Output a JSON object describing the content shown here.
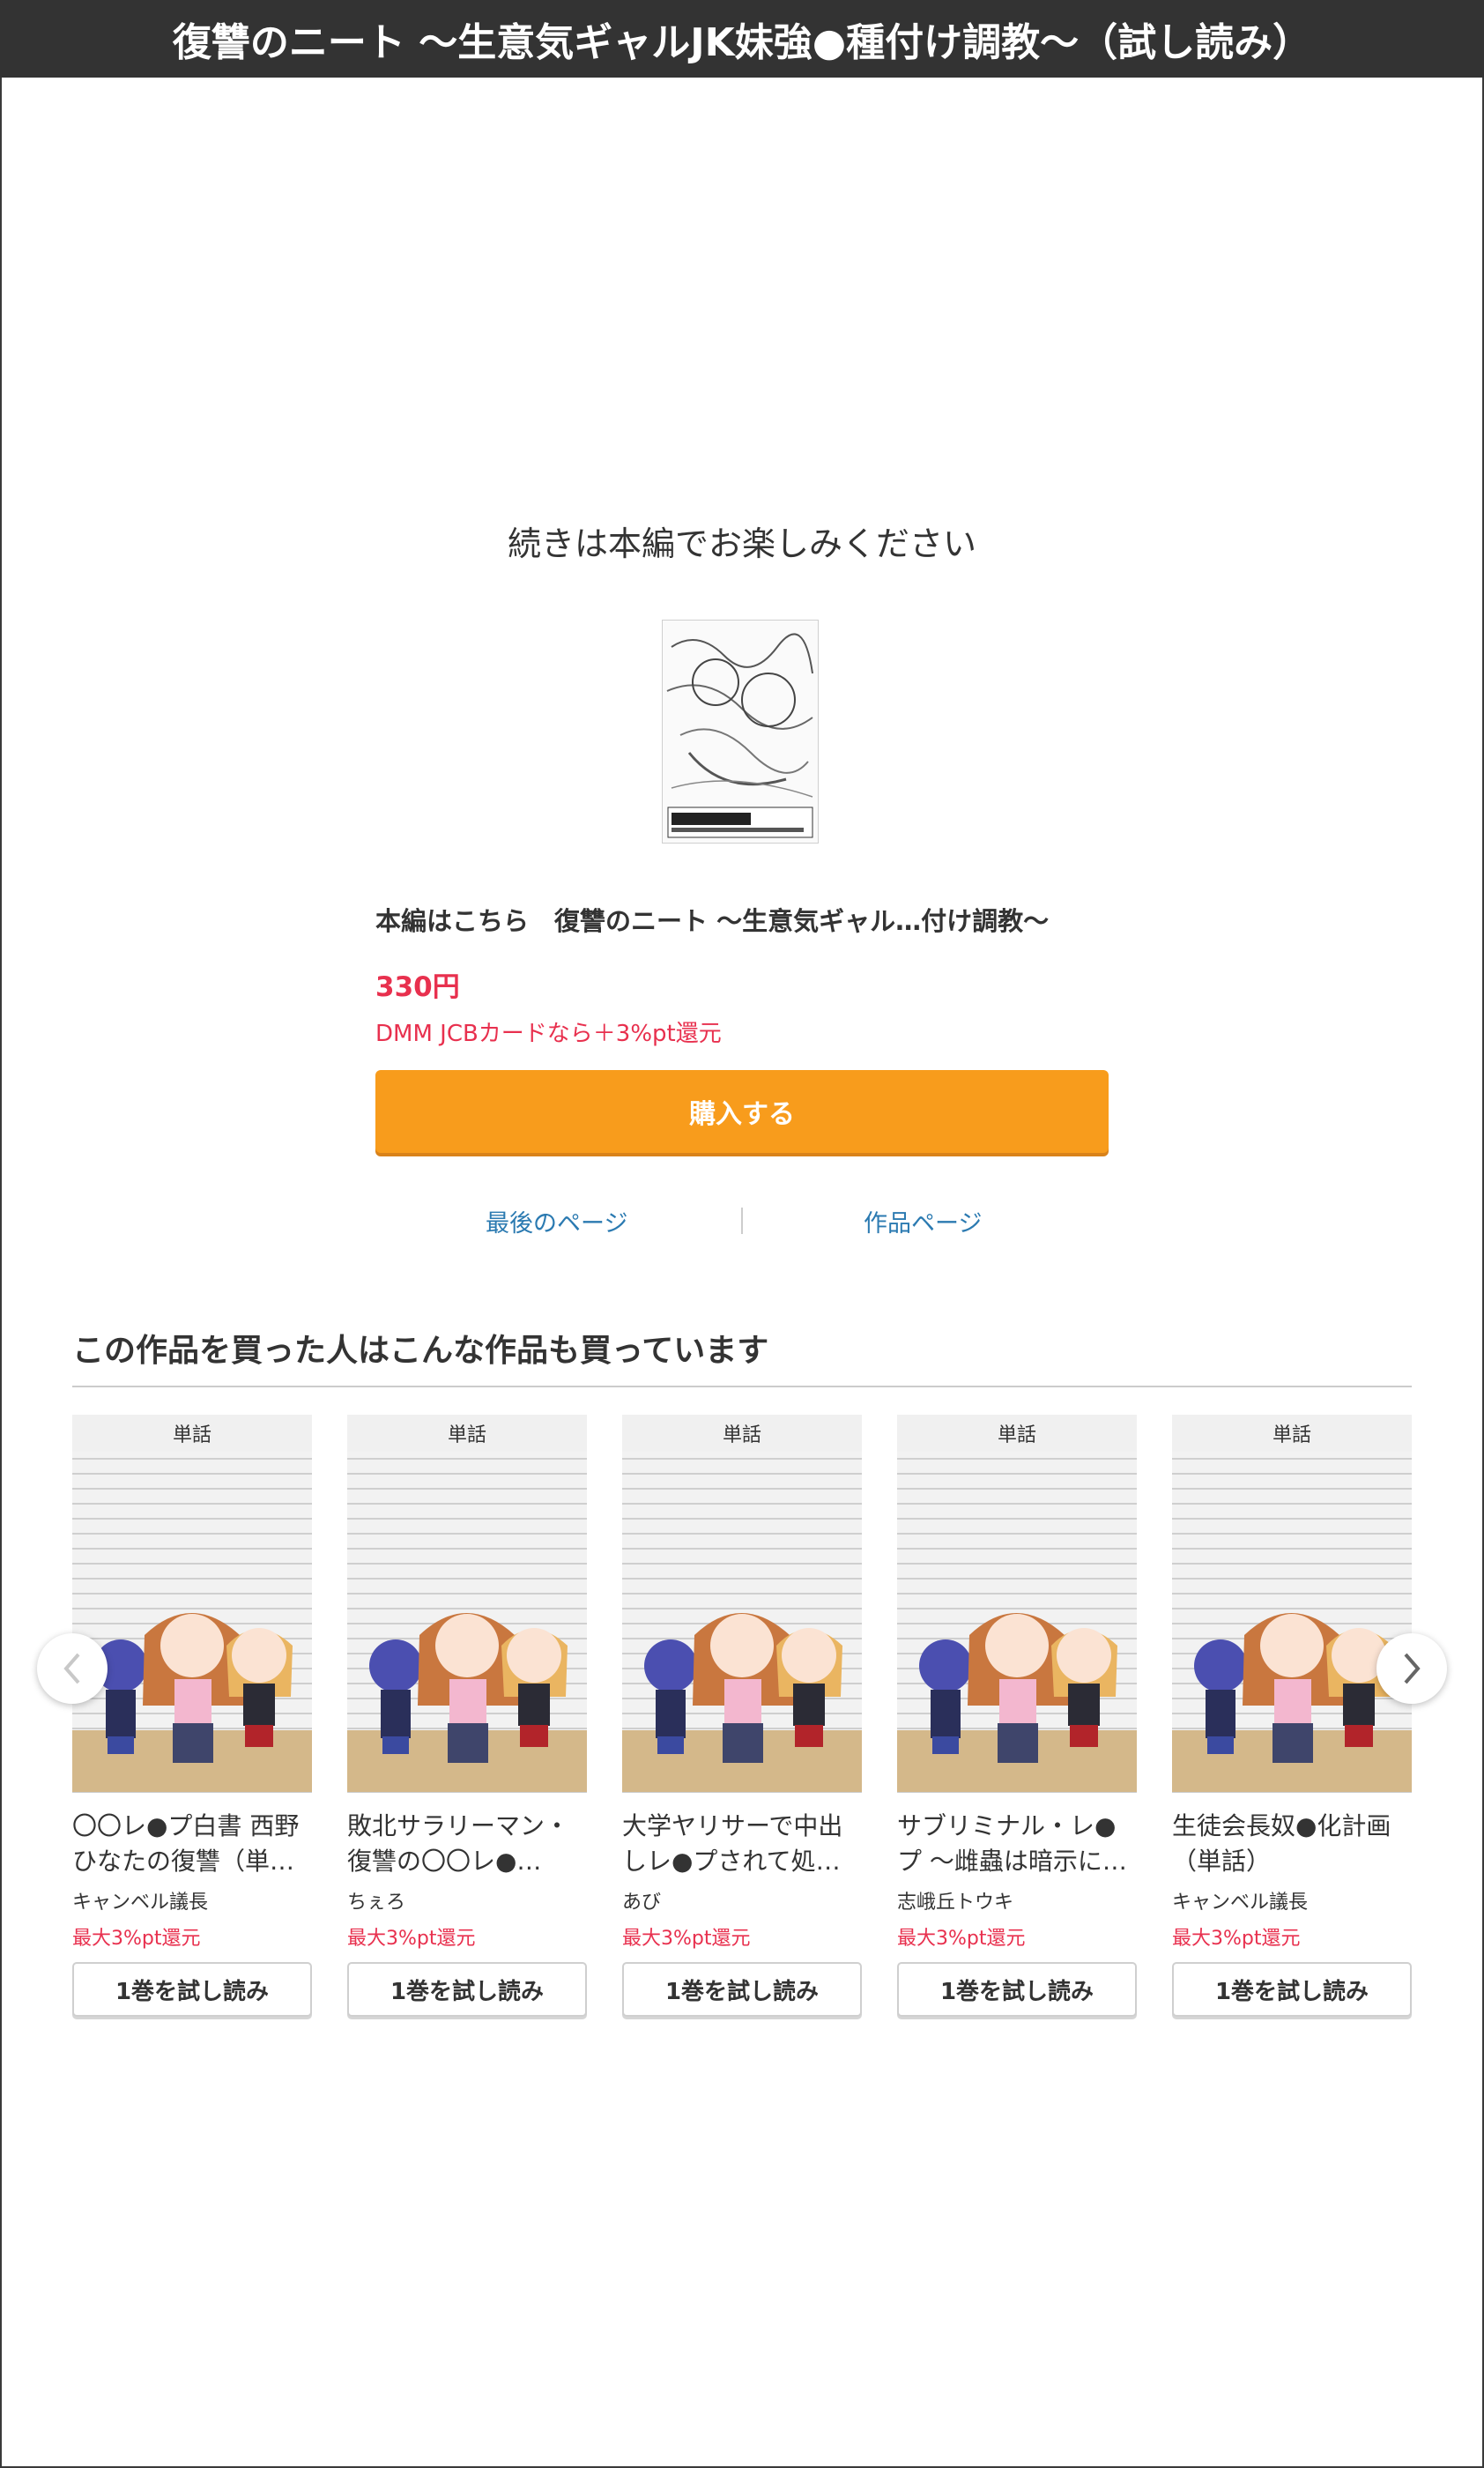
{
  "header": {
    "title": "復讐のニート 〜生意気ギャルJK妹強●種付け調教〜（試し読み）"
  },
  "end_card": {
    "message": "続きは本編でお楽しみください",
    "buy_title": "本編はこちら　復讐のニート 〜生意気ギャル…付け調教〜",
    "price": "330円",
    "point_note": "DMM JCBカードなら＋3%pt還元",
    "buy_button": "購入する",
    "links": {
      "last_page": "最後のページ",
      "work_page": "作品ページ"
    }
  },
  "recommendations": {
    "heading": "この作品を買った人はこんな作品も買っています",
    "items": [
      {
        "badge": "単話",
        "title": "〇〇レ●プ白書 西野ひなたの復讐（単…",
        "author": "キャンベル議長",
        "point": "最大3%pt還元",
        "button": "1巻を試し読み"
      },
      {
        "badge": "単話",
        "title": "敗北サラリーマン・復讐の〇〇レ●…",
        "author": "ちぇろ",
        "point": "最大3%pt還元",
        "button": "1巻を試し読み"
      },
      {
        "badge": "単話",
        "title": "大学ヤリサーで中出しレ●プされて処…",
        "author": "あび",
        "point": "最大3%pt還元",
        "button": "1巻を試し読み"
      },
      {
        "badge": "単話",
        "title": "サブリミナル・レ●プ 〜雌蟲は暗示に…",
        "author": "志峨丘トウキ",
        "point": "最大3%pt還元",
        "button": "1巻を試し読み"
      },
      {
        "badge": "単話",
        "title": "生徒会長奴●化計画（単話）",
        "author": "キャンベル議長",
        "point": "最大3%pt還元",
        "button": "1巻を試し読み"
      }
    ]
  },
  "icons": {
    "prev": "chevron-left-icon",
    "next": "chevron-right-icon"
  },
  "colors": {
    "accent_orange": "#f89c1c",
    "price_red": "#e8304e",
    "link_blue": "#2b7ab1",
    "title_bar": "#333333"
  }
}
